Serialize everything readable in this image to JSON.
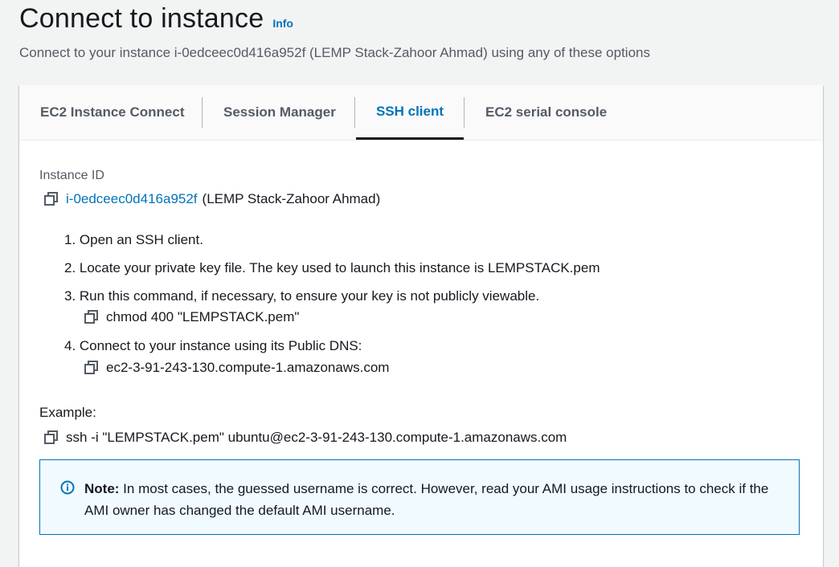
{
  "header": {
    "title": "Connect to instance",
    "info_label": "Info",
    "subtitle": "Connect to your instance i-0edceec0d416a952f (LEMP Stack-Zahoor Ahmad) using any of these options"
  },
  "tabs": [
    {
      "label": "EC2 Instance Connect",
      "active": false
    },
    {
      "label": "Session Manager",
      "active": false
    },
    {
      "label": "SSH client",
      "active": true
    },
    {
      "label": "EC2 serial console",
      "active": false
    }
  ],
  "instance": {
    "label": "Instance ID",
    "id": "i-0edceec0d416a952f",
    "name": "(LEMP Stack-Zahoor Ahmad)"
  },
  "steps": {
    "s1": "1. Open an SSH client.",
    "s2": "2. Locate your private key file. The key used to launch this instance is LEMPSTACK.pem",
    "s3": "3. Run this command, if necessary, to ensure your key is not publicly viewable.",
    "s3_cmd": "chmod 400 \"LEMPSTACK.pem\"",
    "s4": "4. Connect to your instance using its Public DNS:",
    "s4_dns": "ec2-3-91-243-130.compute-1.amazonaws.com"
  },
  "example": {
    "label": "Example:",
    "command": "ssh -i \"LEMPSTACK.pem\" ubuntu@ec2-3-91-243-130.compute-1.amazonaws.com"
  },
  "note": {
    "prefix": "Note:",
    "text": " In most cases, the guessed username is correct. However, read your AMI usage instructions to check if the AMI owner has changed the default AMI username."
  },
  "colors": {
    "accent": "#0073bb",
    "text": "#16191f",
    "muted": "#545b64",
    "note_bg": "#f1faff"
  },
  "icons": {
    "copy": "copy-icon",
    "info": "info-circle-icon"
  }
}
